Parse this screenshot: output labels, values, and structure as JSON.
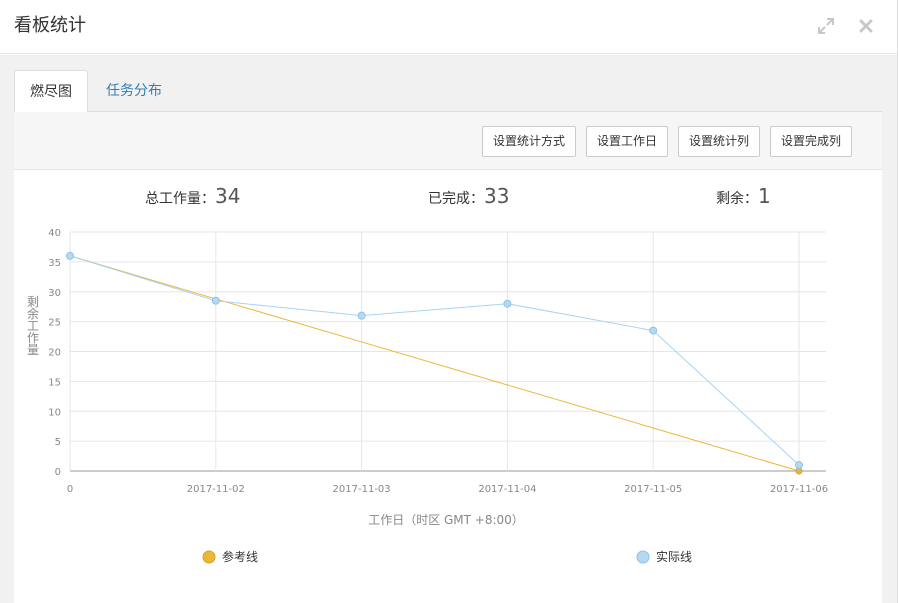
{
  "modal": {
    "title": "看板统计"
  },
  "tabs": [
    {
      "label": "燃尽图",
      "active": true
    },
    {
      "label": "任务分布",
      "active": false
    }
  ],
  "toolbar": {
    "buttons": [
      "设置统计方式",
      "设置工作日",
      "设置统计列",
      "设置完成列"
    ]
  },
  "stats": {
    "total_label": "总工作量：",
    "total_value": "34",
    "done_label": "已完成：",
    "done_value": "33",
    "remain_label": "剩余：",
    "remain_value": "1"
  },
  "colors": {
    "reference": "#e8b83a",
    "actual": "#a8d4f0",
    "tab_link": "#2f7fb8"
  },
  "chart_data": {
    "type": "line",
    "categories": [
      "0",
      "2017-11-02",
      "2017-11-03",
      "2017-11-04",
      "2017-11-05",
      "2017-11-06"
    ],
    "series": [
      {
        "name": "参考线",
        "values": [
          36,
          28.8,
          21.6,
          14.4,
          7.2,
          0
        ]
      },
      {
        "name": "实际线",
        "values": [
          36,
          28.5,
          26,
          28,
          23.5,
          1
        ]
      }
    ],
    "xlabel": "工作日（时区 GMT +8:00）",
    "ylabel": "剩余工作量",
    "ylim": [
      0,
      40
    ],
    "yticks": [
      0,
      5,
      10,
      15,
      20,
      25,
      30,
      35,
      40
    ],
    "grid": true,
    "legend": "bottom"
  }
}
